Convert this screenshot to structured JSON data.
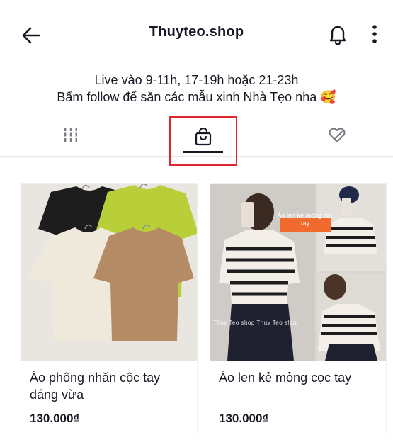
{
  "header": {
    "title": "Thuyteo.shop",
    "back_icon": "arrow-left-icon",
    "bell_icon": "bell-icon",
    "more_icon": "more-vertical-icon"
  },
  "bio": {
    "line1": "Live vào 9-11h, 17-19h hoặc 21-23h",
    "line2": "Bấm follow để săn các mẫu xinh Nhà Tẹo nha 🥰"
  },
  "tabs": [
    {
      "name": "videos",
      "icon": "grid-bars-icon",
      "selected": false
    },
    {
      "name": "shop",
      "icon": "shopping-bag-icon",
      "selected": true
    },
    {
      "name": "liked",
      "icon": "heart-hidden-icon",
      "selected": false
    }
  ],
  "products": [
    {
      "title": "Áo phông nhăn cộc tay dáng vừa",
      "price": "130.000₫"
    },
    {
      "title": "Áo len kẻ mỏng cọc tay",
      "price": "130.000₫",
      "image_overlay": "Áo len kẻ mỏng cọc tay",
      "watermark": "Thuy Teo shop Thuy Teo shop"
    }
  ],
  "colors": {
    "text": "#161823",
    "highlight_border": "#e0262e",
    "overlay_badge": "#f26a2e",
    "shirt_lime": "#b9cf3a",
    "shirt_black": "#1d1d1d",
    "shirt_cream": "#efe9dc",
    "shirt_tan": "#b58b66"
  }
}
